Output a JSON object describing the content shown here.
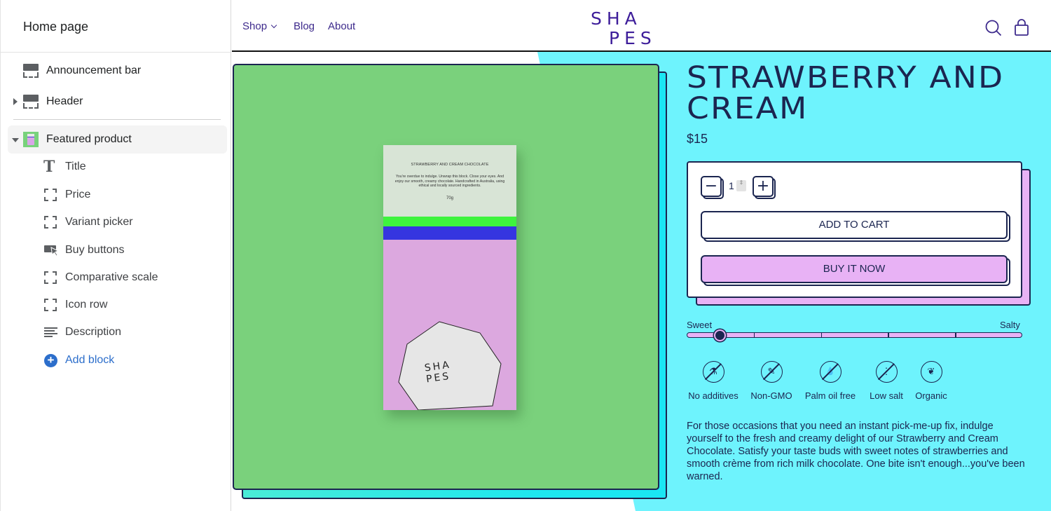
{
  "sidebar": {
    "title": "Home page",
    "sections": [
      {
        "label": "Announcement bar",
        "expandable": false
      },
      {
        "label": "Header",
        "expandable": true,
        "expanded": false
      },
      {
        "label": "Featured product",
        "expandable": true,
        "expanded": true,
        "selected": true
      }
    ],
    "blocks": [
      {
        "label": "Title",
        "icon": "text-icon"
      },
      {
        "label": "Price",
        "icon": "placeholder-bracket-icon"
      },
      {
        "label": "Variant picker",
        "icon": "placeholder-bracket-icon"
      },
      {
        "label": "Buy buttons",
        "icon": "buy-button-cursor-icon"
      },
      {
        "label": "Comparative scale",
        "icon": "placeholder-bracket-icon"
      },
      {
        "label": "Icon row",
        "icon": "placeholder-bracket-icon"
      },
      {
        "label": "Description",
        "icon": "text-align-lines-icon"
      }
    ],
    "add_block_label": "Add block",
    "add_block_icon": "plus-circle-icon"
  },
  "store": {
    "nav": [
      {
        "label": "Shop",
        "has_dropdown": true
      },
      {
        "label": "Blog"
      },
      {
        "label": "About"
      }
    ],
    "logo_line1": "SHA",
    "logo_line2": "PES",
    "icons": [
      "search-icon",
      "shopping-bag-icon"
    ],
    "colors": {
      "brand_purple": "#3d1d9a",
      "ink": "#1b2550",
      "cyan": "#6ef3fd",
      "green": "#7ad17c",
      "pink": "#e8b2f5"
    }
  },
  "product_image": {
    "package_title": "STRAWBERRY AND CREAM CHOCOLATE",
    "package_text": "You're overdue to indulge. Unwrap this block. Close your eyes. And enjoy our smooth, creamy chocolate. Handcrafted in Australia, using ethical and locally sourced ingredients.",
    "package_weight": "70g",
    "package_logo_line1": "SHA",
    "package_logo_line2": "PES"
  },
  "product": {
    "title": "STRAWBERRY AND CREAM",
    "price": "$15",
    "quantity": "1",
    "quantity_spin": "⇕",
    "decrease_label": "−",
    "increase_label": "+",
    "add_to_cart_label": "ADD TO CART",
    "buy_now_label": "BUY IT NOW",
    "scale": {
      "left_label": "Sweet",
      "right_label": "Salty",
      "value_fraction": 0.1,
      "segments": 5
    },
    "badges": [
      {
        "label": "No additives",
        "icon": "no-additives-icon",
        "glyph": "⚗"
      },
      {
        "label": "Non-GMO",
        "icon": "non-gmo-icon",
        "glyph": "✎"
      },
      {
        "label": "Palm oil free",
        "icon": "palm-oil-free-icon",
        "glyph": "💧"
      },
      {
        "label": "Low salt",
        "icon": "low-salt-icon",
        "glyph": "⋮"
      },
      {
        "label": "Organic",
        "icon": "organic-leaf-icon",
        "glyph": "❦"
      }
    ],
    "description": "For those occasions that you need an instant pick-me-up fix, indulge yourself to the fresh and creamy delight of our Strawberry and Cream Chocolate. Satisfy your taste buds with sweet notes of strawberries and smooth crème from rich milk chocolate. One bite isn't enough...you've been warned."
  }
}
